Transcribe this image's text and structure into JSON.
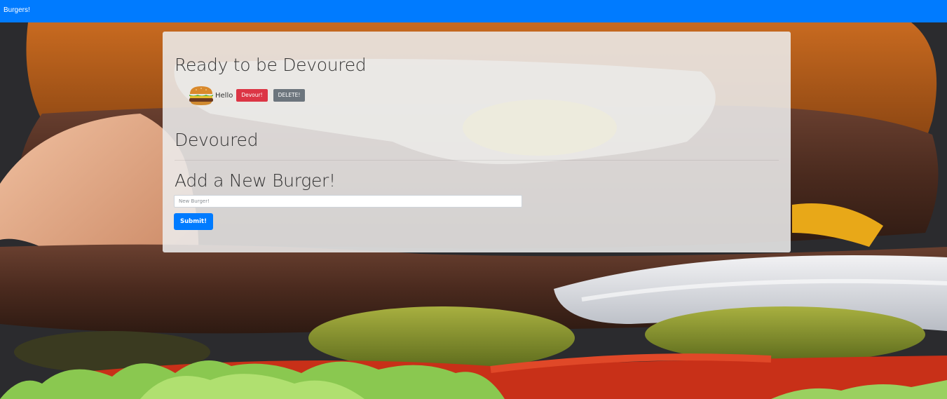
{
  "navbar": {
    "brand": "Burgers!"
  },
  "background": {
    "icon": "burger-photo"
  },
  "ready": {
    "heading": "Ready to be Devoured",
    "burgers": [
      {
        "name": "Hello",
        "icon": "hamburger-icon",
        "devour_label": "Devour!",
        "delete_label": "DELETE!"
      }
    ]
  },
  "devoured": {
    "heading": "Devoured"
  },
  "add": {
    "heading": "Add a New Burger!",
    "input_value": "",
    "input_placeholder": "New Burger!",
    "submit_label": "Submit!"
  },
  "colors": {
    "navbar": "#007bff",
    "devour": "#dc3545",
    "delete": "#6c757d",
    "submit": "#007bff"
  }
}
